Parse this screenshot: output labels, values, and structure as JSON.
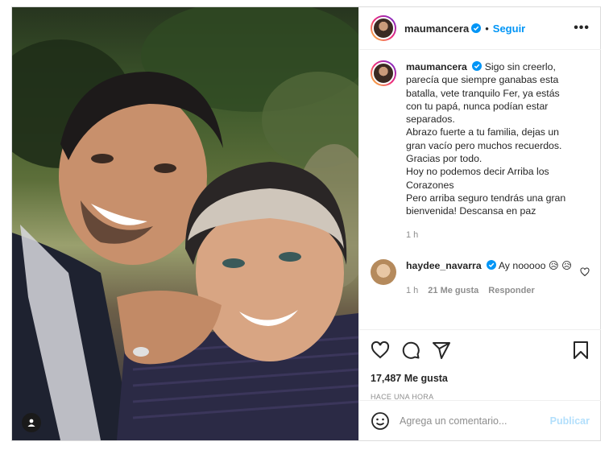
{
  "post": {
    "author": "maumancera",
    "follow_label": "Seguir",
    "separator": "•",
    "more_label": "•••",
    "caption": {
      "author": "maumancera",
      "lines": [
        "Sigo sin creerlo,",
        "parecía que siempre ganabas esta",
        "batalla, vete tranquilo Fer, ya estás",
        "con tu papá, nunca podían estar",
        "separados.",
        "Abrazo fuerte a tu familia, dejas un",
        "gran vacío pero muchos recuerdos.",
        "Gracias por todo.",
        "Hoy no podemos decir Arriba los",
        "Corazones",
        "Pero arriba seguro tendrás una gran",
        "bienvenida! Descansa en paz"
      ],
      "time": "1 h"
    },
    "comments": [
      {
        "author": "haydee_navarra",
        "text": "Ay nooooo",
        "emoji": "😥 😥",
        "time": "1 h",
        "likes": "21 Me gusta",
        "reply_label": "Responder"
      }
    ],
    "likes": "17,487 Me gusta",
    "posted_when": "HACE UNA HORA",
    "comment_input_placeholder": "Agrega un comentario...",
    "publish_label": "Publicar"
  },
  "colors": {
    "accent": "#0095f6",
    "publish_disabled": "#b2dffc",
    "muted": "#8e8e8e",
    "border": "#dbdbdb"
  },
  "icons": [
    "user-tag-icon",
    "verified-icon",
    "heart-icon",
    "comment-icon",
    "share-icon",
    "bookmark-icon",
    "emoji-icon",
    "more-icon"
  ]
}
